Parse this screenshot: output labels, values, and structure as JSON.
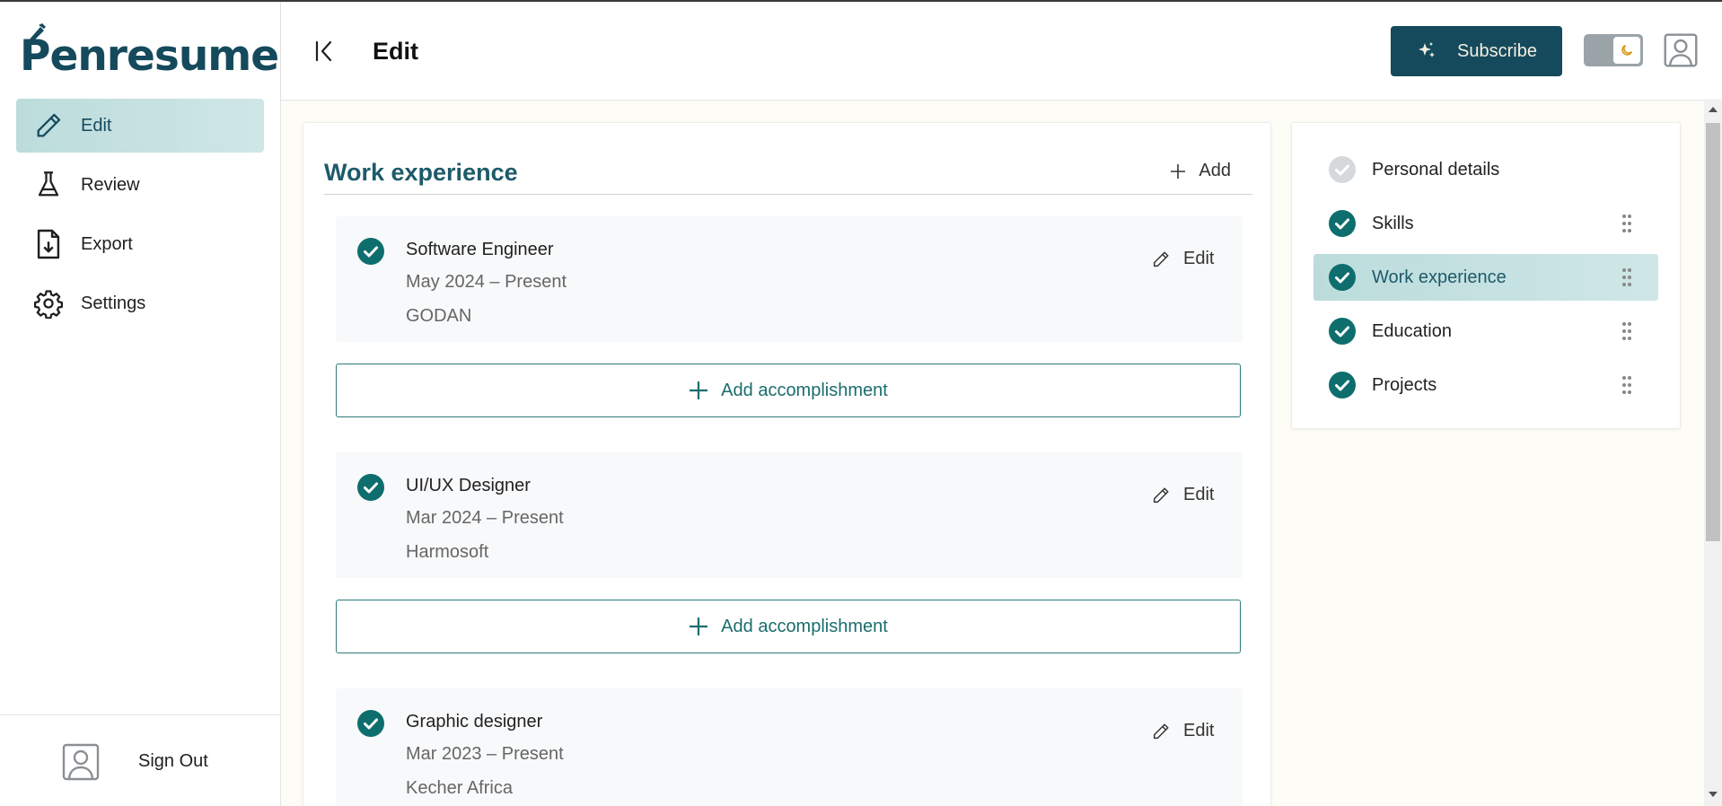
{
  "app": {
    "name": "Penresume"
  },
  "sidebar": {
    "items": [
      {
        "label": "Edit",
        "icon": "pencil-icon",
        "active": true
      },
      {
        "label": "Review",
        "icon": "flask-icon"
      },
      {
        "label": "Export",
        "icon": "file-download-icon"
      },
      {
        "label": "Settings",
        "icon": "gear-icon"
      }
    ],
    "sign_out_label": "Sign Out"
  },
  "header": {
    "title": "Edit",
    "subscribe_label": "Subscribe"
  },
  "work_experience": {
    "title": "Work experience",
    "add_label": "Add",
    "edit_label": "Edit",
    "add_accomplishment_label": "Add accomplishment",
    "jobs": [
      {
        "title": "Software Engineer",
        "dates": "May 2024 – Present",
        "company": "GODAN"
      },
      {
        "title": "UI/UX Designer",
        "dates": "Mar 2024 – Present",
        "company": "Harmosoft"
      },
      {
        "title": "Graphic designer",
        "dates": "Mar 2023 – Present",
        "company": "Kecher Africa"
      }
    ]
  },
  "sections": [
    {
      "label": "Personal details",
      "complete": false,
      "draggable": false
    },
    {
      "label": "Skills",
      "complete": true,
      "draggable": true
    },
    {
      "label": "Work experience",
      "complete": true,
      "draggable": true,
      "active": true
    },
    {
      "label": "Education",
      "complete": true,
      "draggable": true
    },
    {
      "label": "Projects",
      "complete": true,
      "draggable": true
    }
  ],
  "colors": {
    "brand": "#154a5c",
    "accent": "#1b6d6d",
    "check_complete": "#0e6e6e",
    "check_incomplete": "#d5d9dc",
    "active_bg": "#c5e1e1",
    "main_bg": "#fdfcf6"
  }
}
